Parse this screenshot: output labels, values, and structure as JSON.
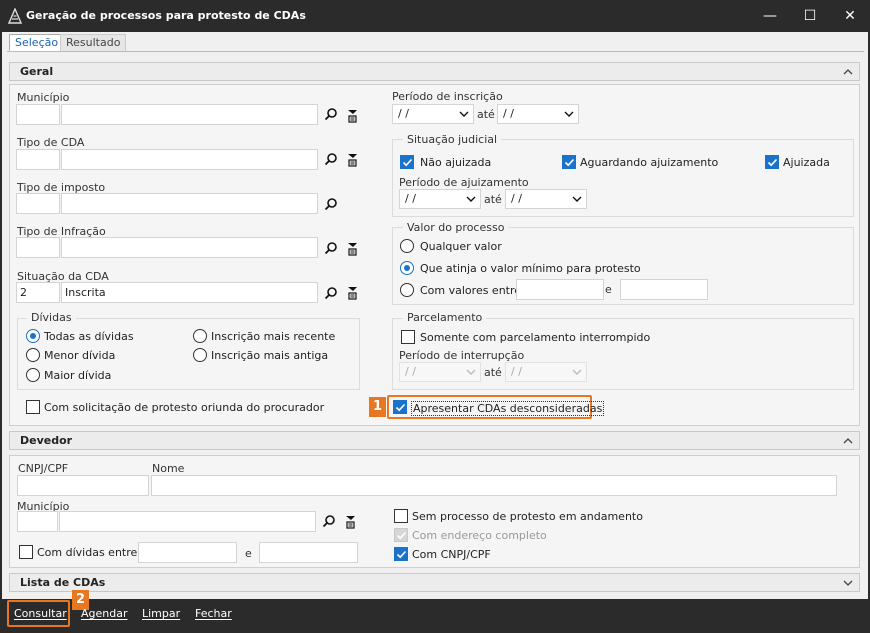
{
  "window": {
    "title": "Geração de processos para protesto de CDAs",
    "minimize": "—",
    "maximize": "☐",
    "close": "✕"
  },
  "tabs": [
    {
      "label": "Seleção",
      "active": true
    },
    {
      "label": "Resultado",
      "active": false
    }
  ],
  "geral": {
    "title": "Geral",
    "municipio": {
      "label": "Município",
      "code": "",
      "name": ""
    },
    "tipo_cda": {
      "label": "Tipo de CDA",
      "code": "",
      "name": ""
    },
    "tipo_imposto": {
      "label": "Tipo de imposto",
      "code": "",
      "name": ""
    },
    "tipo_infracao": {
      "label": "Tipo de Infração",
      "code": "",
      "name": ""
    },
    "situacao_cda": {
      "label": "Situação da CDA",
      "code": "2",
      "name": "Inscrita"
    },
    "dividas": {
      "title": "Dívidas",
      "options": [
        {
          "label": "Todas as dívidas",
          "checked": true
        },
        {
          "label": "Menor dívida",
          "checked": false
        },
        {
          "label": "Maior dívida",
          "checked": false
        },
        {
          "label": "Inscrição mais recente",
          "checked": false
        },
        {
          "label": "Inscrição mais antiga",
          "checked": false
        }
      ]
    },
    "com_solicitacao": {
      "label": "Com solicitação de protesto oriunda do procurador",
      "checked": false
    },
    "periodo_inscricao": {
      "label": "Período de inscrição",
      "from": "/ /",
      "ate": "até",
      "to": "/ /"
    },
    "situacao_judicial": {
      "title": "Situação judicial",
      "nao_ajuizada": {
        "label": "Não ajuizada",
        "checked": true
      },
      "aguardando": {
        "label": "Aguardando ajuizamento",
        "checked": true
      },
      "ajuizada": {
        "label": "Ajuizada",
        "checked": true
      },
      "periodo_ajuizamento": {
        "label": "Período de ajuizamento",
        "from": "/ /",
        "ate": "até",
        "to": "/ /"
      }
    },
    "valor_processo": {
      "title": "Valor do processo",
      "qualquer": {
        "label": "Qualquer valor",
        "checked": false
      },
      "minimo": {
        "label": "Que atinja o valor mínimo para protesto",
        "checked": true
      },
      "entre": {
        "label": "Com valores entre",
        "checked": false,
        "e": "e",
        "from": "",
        "to": ""
      }
    },
    "parcelamento": {
      "title": "Parcelamento",
      "somente": {
        "label": "Somente com parcelamento interrompido",
        "checked": false
      },
      "periodo_interrupcao": {
        "label": "Período de interrupção",
        "from": "/ /",
        "ate": "até",
        "to": "/ /"
      }
    },
    "apresentar": {
      "label": "Apresentar CDAs desconsideradas",
      "checked": true,
      "badge": "1"
    }
  },
  "devedor": {
    "title": "Devedor",
    "cnpj": {
      "label": "CNPJ/CPF",
      "value": ""
    },
    "nome": {
      "label": "Nome",
      "value": ""
    },
    "municipio": {
      "label": "Município",
      "code": "",
      "name": ""
    },
    "com_dividas": {
      "label": "Com dívidas entre",
      "checked": false,
      "e": "e",
      "from": "",
      "to": ""
    },
    "sem_processo": {
      "label": "Sem processo de protesto em andamento",
      "checked": false
    },
    "com_endereco": {
      "label": "Com endereço completo",
      "checked": true,
      "disabled": true
    },
    "com_cnpj": {
      "label": "Com CNPJ/CPF",
      "checked": true
    }
  },
  "lista": {
    "title": "Lista de CDAs"
  },
  "footer": {
    "consultar": "Consultar",
    "agendar": "Agendar",
    "limpar": "Limpar",
    "fechar": "Fechar",
    "badge": "2"
  },
  "colors": {
    "accent": "#1a73c8",
    "callout": "#e87722",
    "titlebar": "#2b2b2b"
  }
}
